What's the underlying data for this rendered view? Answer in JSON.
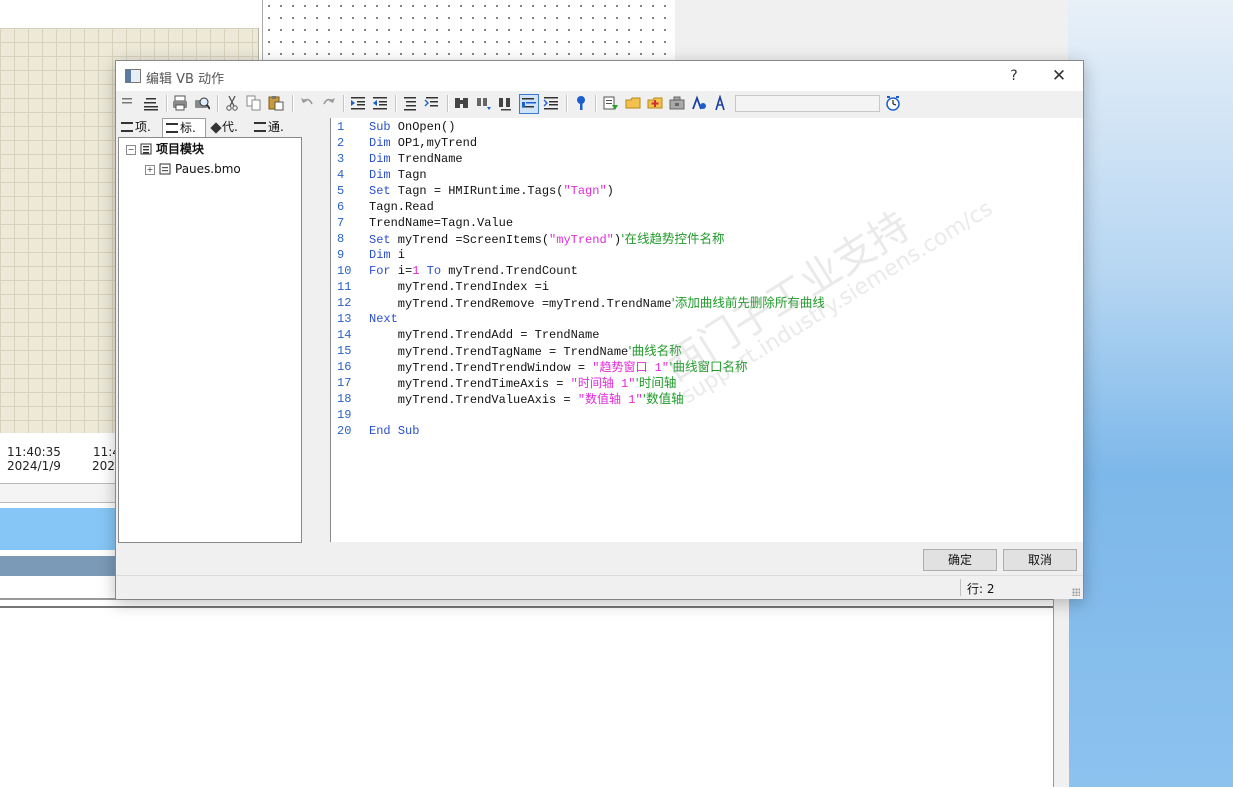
{
  "background": {
    "time_label": "11:40:35",
    "date_label": "2024/1/9",
    "time_label_partial": "11:4",
    "date_label_partial": "2024"
  },
  "dialog": {
    "title": "编辑 VB 动作",
    "help": "?",
    "close": "✕"
  },
  "tree_tabs": [
    {
      "label": "项."
    },
    {
      "label": "标."
    },
    {
      "label": "代."
    },
    {
      "label": "通."
    }
  ],
  "tree": {
    "root": "项目模块",
    "child": "Paues.bmo",
    "root_toggle": "−",
    "child_toggle": "+"
  },
  "code_lines": [
    {
      "n": "1",
      "parts": [
        [
          "kw",
          "Sub"
        ],
        [
          "t",
          " OnOpen()"
        ]
      ]
    },
    {
      "n": "2",
      "parts": [
        [
          "kw",
          "Dim"
        ],
        [
          "t",
          " OP1,myTrend"
        ]
      ]
    },
    {
      "n": "3",
      "parts": [
        [
          "kw",
          "Dim"
        ],
        [
          "t",
          " TrendName"
        ]
      ]
    },
    {
      "n": "4",
      "parts": [
        [
          "kw",
          "Dim"
        ],
        [
          "t",
          " Tagn"
        ]
      ]
    },
    {
      "n": "5",
      "parts": [
        [
          "kw",
          "Set"
        ],
        [
          "t",
          " Tagn = HMIRuntime.Tags("
        ],
        [
          "str",
          "\"Tagn\""
        ],
        [
          "t",
          ")"
        ]
      ]
    },
    {
      "n": "6",
      "parts": [
        [
          "t",
          "Tagn.Read"
        ]
      ]
    },
    {
      "n": "7",
      "parts": [
        [
          "t",
          "TrendName=Tagn.Value"
        ]
      ]
    },
    {
      "n": "8",
      "parts": [
        [
          "kw",
          "Set"
        ],
        [
          "t",
          " myTrend =ScreenItems("
        ],
        [
          "str",
          "\"myTrend\""
        ],
        [
          "t",
          ")"
        ],
        [
          "cm",
          "'在线趋势控件名称"
        ]
      ]
    },
    {
      "n": "9",
      "parts": [
        [
          "kw",
          "Dim"
        ],
        [
          "t",
          " i"
        ]
      ]
    },
    {
      "n": "10",
      "parts": [
        [
          "kw",
          "For"
        ],
        [
          "t",
          " i="
        ],
        [
          "num",
          "1"
        ],
        [
          "t",
          " "
        ],
        [
          "kw",
          "To"
        ],
        [
          "t",
          " myTrend.TrendCount"
        ]
      ]
    },
    {
      "n": "11",
      "parts": [
        [
          "t",
          "    myTrend.TrendIndex =i"
        ]
      ]
    },
    {
      "n": "12",
      "parts": [
        [
          "t",
          "    myTrend.TrendRemove =myTrend.TrendName"
        ],
        [
          "cm",
          "'添加曲线前先删除所有曲线"
        ]
      ]
    },
    {
      "n": "13",
      "parts": [
        [
          "kw",
          "Next"
        ]
      ]
    },
    {
      "n": "14",
      "parts": [
        [
          "t",
          "    myTrend.TrendAdd = TrendName"
        ]
      ]
    },
    {
      "n": "15",
      "parts": [
        [
          "t",
          "    myTrend.TrendTagName = TrendName"
        ],
        [
          "cm",
          "'曲线名称"
        ]
      ]
    },
    {
      "n": "16",
      "parts": [
        [
          "t",
          "    myTrend.TrendTrendWindow = "
        ],
        [
          "str",
          "\"趋势窗口 1\""
        ],
        [
          "cm",
          "'曲线窗口名称"
        ]
      ]
    },
    {
      "n": "17",
      "parts": [
        [
          "t",
          "    myTrend.TrendTimeAxis = "
        ],
        [
          "str",
          "\"时间轴 1\""
        ],
        [
          "cm",
          "'时间轴"
        ]
      ]
    },
    {
      "n": "18",
      "parts": [
        [
          "t",
          "    myTrend.TrendValueAxis = "
        ],
        [
          "str",
          "\"数值轴 1\""
        ],
        [
          "cm",
          "'数值轴"
        ]
      ]
    },
    {
      "n": "19",
      "parts": []
    },
    {
      "n": "20",
      "parts": [
        [
          "kw",
          "End"
        ],
        [
          "t",
          " "
        ],
        [
          "kw",
          "Sub"
        ]
      ]
    }
  ],
  "watermark": {
    "line1": "西门子工业支持",
    "line2": "support.industry.siemens.com/cs"
  },
  "buttons": {
    "ok": "确定",
    "cancel": "取消"
  },
  "status": {
    "line_label": "行:  2"
  },
  "colors": {
    "keyword": "#2a4fd0",
    "string": "#e12ad8",
    "comment": "#1e9a28",
    "line_number": "#2a62c9"
  }
}
